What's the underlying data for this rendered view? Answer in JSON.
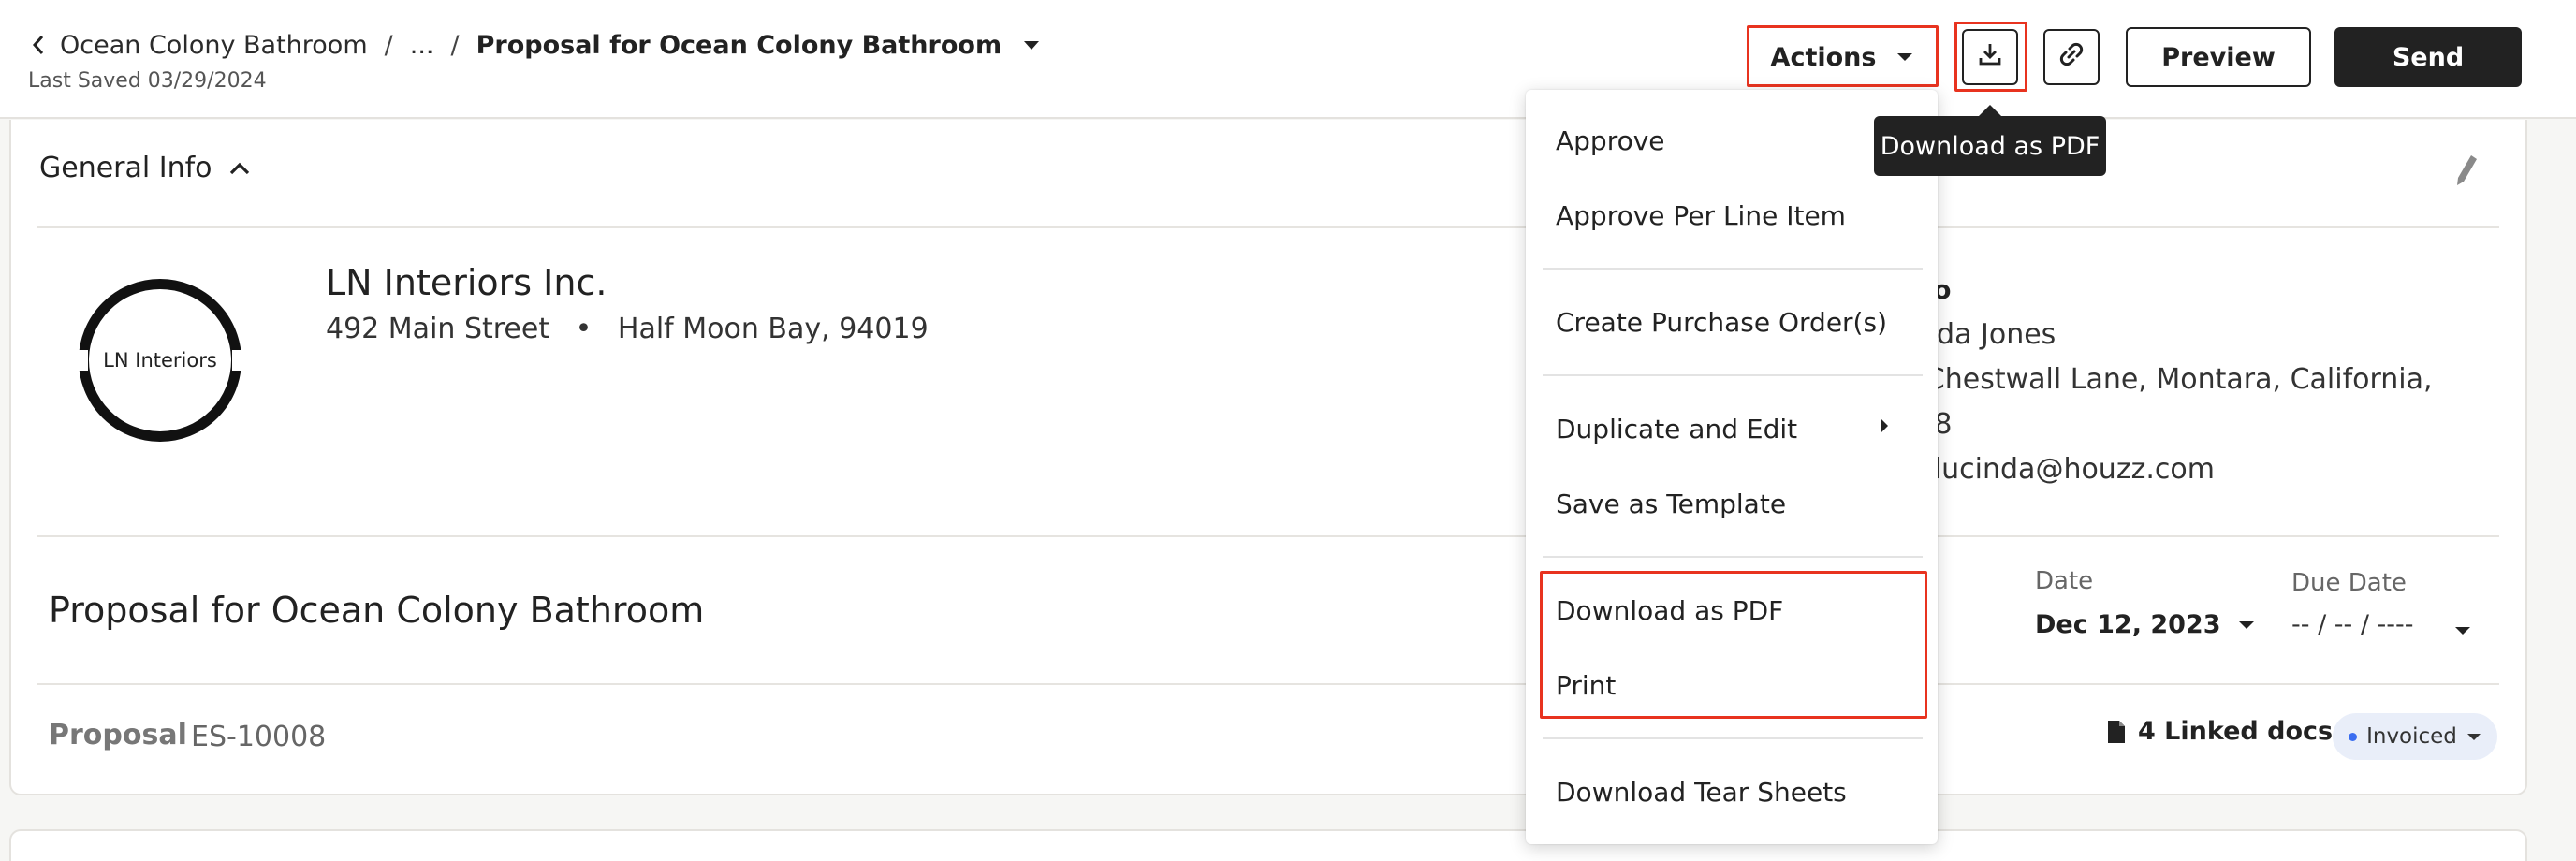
{
  "header": {
    "breadcrumbs": [
      "Ocean Colony Bathroom",
      "...",
      "Proposal for Ocean Colony Bathroom"
    ],
    "last_saved": "Last Saved 03/29/2024"
  },
  "toolbar": {
    "actions_label": "Actions",
    "preview_label": "Preview",
    "send_label": "Send",
    "download_tooltip": "Download as PDF"
  },
  "actions_menu": {
    "items": [
      "Approve",
      "Approve Per Line Item",
      "Create Purchase Order(s)",
      "Duplicate and Edit",
      "Save as Template",
      "Download as PDF",
      "Print",
      "Download Tear Sheets"
    ]
  },
  "general_info": {
    "title": "General Info",
    "company": {
      "logo_text": "LN Interiors",
      "name": "LN Interiors Inc.",
      "street": "492 Main Street",
      "city": "Half Moon Bay, 94019"
    },
    "bill_to": {
      "label": "Bill To",
      "lines": [
        "Lucinda Jones",
        "123 Chestwall Lane, Montara, California,",
        "94018",
        "lisa+lucinda@houzz.com"
      ]
    },
    "proposal_title": "Proposal for Ocean Colony Bathroom",
    "date_label": "Date",
    "date_value": "Dec 12, 2023",
    "due_date_label": "Due Date",
    "due_date_value": "-- / -- / ----",
    "doc_type": "Proposal",
    "doc_number": "ES-10008",
    "linked_docs": "4 Linked docs",
    "status": "Invoiced"
  },
  "colors": {
    "highlight": "#e8331f",
    "primary_dark": "#222222",
    "status_dot": "#3a6df0",
    "status_bg": "#e9eef9"
  }
}
